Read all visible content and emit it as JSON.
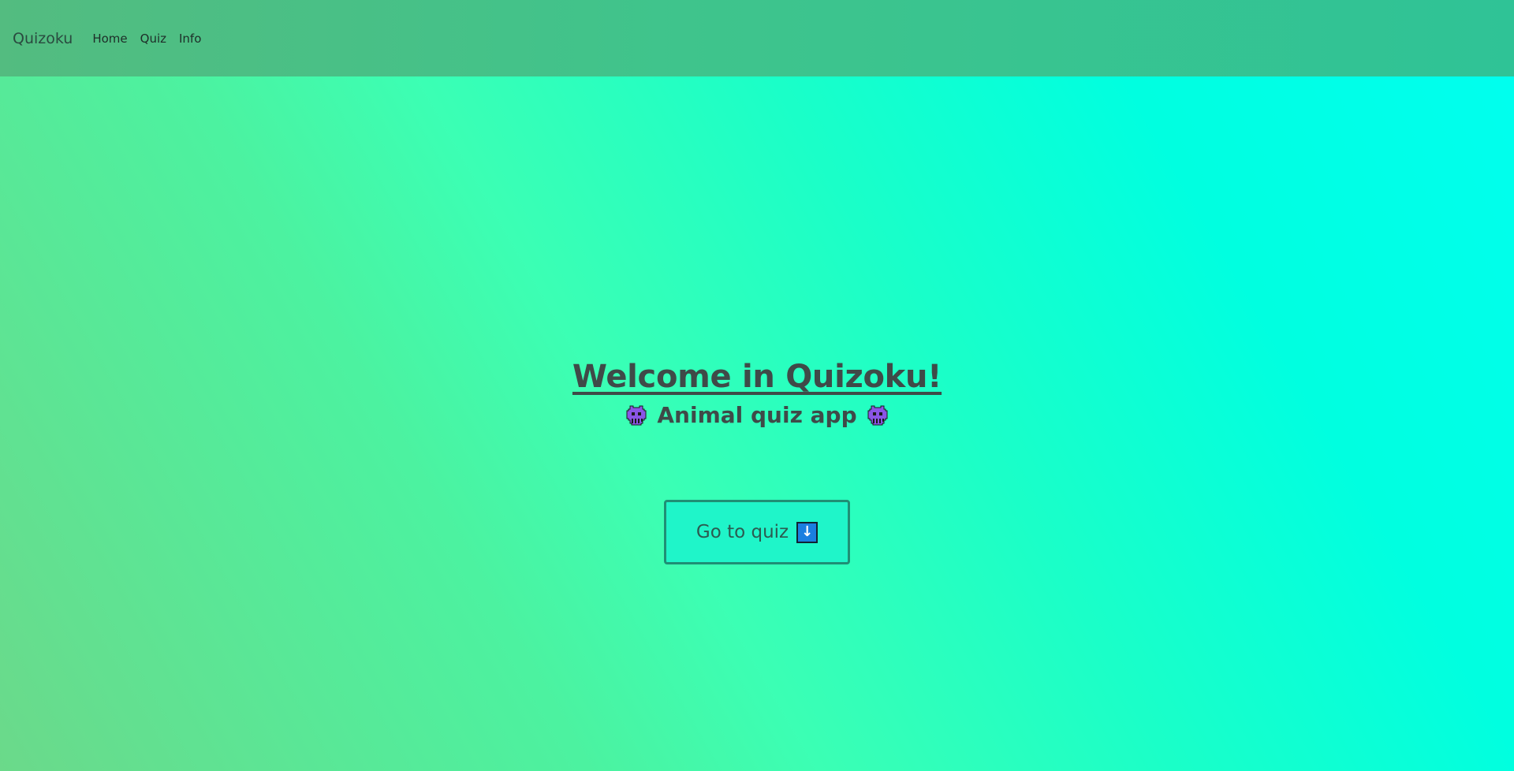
{
  "navbar": {
    "brand": "Quizoku",
    "links": [
      "Home",
      "Quiz",
      "Info"
    ]
  },
  "hero": {
    "title": "Welcome in Quizoku!",
    "subtitle": "Animal quiz app",
    "subtitle_icon": "purple-space-invader-icon"
  },
  "cta": {
    "label": "Go to quiz",
    "icon": "down-arrow-icon",
    "icon_glyph": "↓"
  },
  "colors": {
    "text": "#3f4a48",
    "button_border": "#1f8f75",
    "button_bg": "#1ff5c9",
    "arrow_bg": "#1a7fe0",
    "invader": "#8a55e6"
  }
}
